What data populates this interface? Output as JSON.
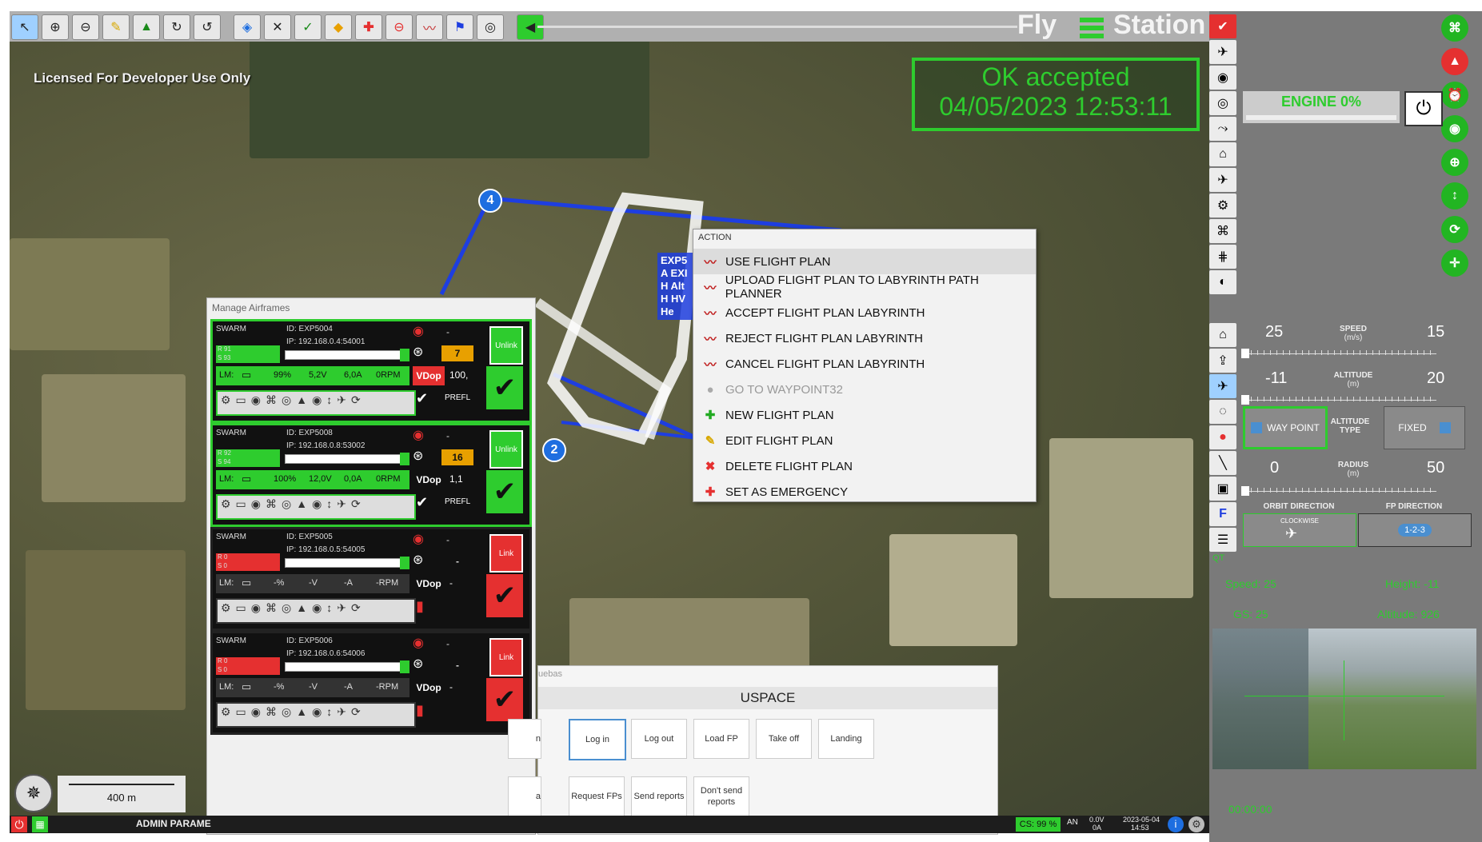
{
  "app": {
    "title_left": "Fly",
    "title_right": "Station",
    "license": "Licensed For Developer Use Only"
  },
  "status_box": {
    "line1": "OK accepted",
    "line2": "04/05/2023 12:53:11"
  },
  "engine": {
    "label": "ENGINE 0%"
  },
  "waypoints": {
    "w4": "4",
    "w2": "2"
  },
  "drone_label": {
    "id": "EXP5",
    "a": "A EXI",
    "h": "H Alt",
    "h2": "H HV",
    "he": "He"
  },
  "action_menu": {
    "header": "ACTION",
    "items": [
      {
        "label": "USE FLIGHT PLAN",
        "icon": "flight-plan-icon",
        "state": "active"
      },
      {
        "label": "UPLOAD FLIGHT PLAN TO LABYRINTH PATH PLANNER",
        "icon": "flight-plan-icon",
        "state": "normal"
      },
      {
        "label": "ACCEPT FLIGHT PLAN LABYRINTH",
        "icon": "flight-plan-icon",
        "state": "normal"
      },
      {
        "label": "REJECT FLIGHT PLAN LABYRINTH",
        "icon": "flight-plan-icon",
        "state": "normal"
      },
      {
        "label": "CANCEL FLIGHT PLAN LABYRINTH",
        "icon": "flight-plan-icon",
        "state": "normal"
      },
      {
        "label": "GO TO WAYPOINT32",
        "icon": "circle-icon",
        "state": "disabled"
      },
      {
        "label": "NEW FLIGHT PLAN",
        "icon": "plus-icon",
        "state": "normal"
      },
      {
        "label": "EDIT FLIGHT PLAN",
        "icon": "pencil-icon",
        "state": "normal"
      },
      {
        "label": "DELETE FLIGHT PLAN",
        "icon": "delete-icon",
        "state": "normal"
      },
      {
        "label": "SET AS EMERGENCY",
        "icon": "emergency-icon",
        "state": "normal"
      }
    ]
  },
  "manage_airframes": {
    "title": "Manage Airframes",
    "cards": [
      {
        "swarm": "SWARM",
        "id": "ID: EXP5004",
        "ip": "IP: 192.168.0.4:54001",
        "r": "R 91",
        "s": "S 93",
        "lm": "LM:",
        "batt": "99%",
        "volt": "5,2V",
        "amp": "6,0A",
        "rpm": "0RPM",
        "vdop": "VDop",
        "sats": "7",
        "vdop_val": "100,",
        "prefl": "PREFL",
        "dash": "-",
        "link": "Unlink",
        "linked": true,
        "color": "#2ecc2e"
      },
      {
        "swarm": "SWARM",
        "id": "ID: EXP5008",
        "ip": "IP: 192.168.0.8:53002",
        "r": "R 92",
        "s": "S 94",
        "lm": "LM:",
        "batt": "100%",
        "volt": "12,0V",
        "amp": "0,0A",
        "rpm": "0RPM",
        "vdop": "VDop",
        "sats": "16",
        "vdop_val": "1,1",
        "prefl": "PREFL",
        "dash": "-",
        "link": "Unlink",
        "linked": true,
        "color": "#2ecc2e"
      },
      {
        "swarm": "SWARM",
        "id": "ID: EXP5005",
        "ip": "IP: 192.168.0.5:54005",
        "r": "R 0",
        "s": "S 0",
        "lm": "LM:",
        "batt": "-%",
        "volt": "-V",
        "amp": "-A",
        "rpm": "-RPM",
        "vdop": "VDop",
        "sats": "-",
        "vdop_val": "-",
        "prefl": "",
        "dash": "-",
        "link": "Link",
        "linked": false,
        "color": "#e53030"
      },
      {
        "swarm": "SWARM",
        "id": "ID: EXP5006",
        "ip": "IP: 192.168.0.6:54006",
        "r": "R 0",
        "s": "S 0",
        "lm": "LM:",
        "batt": "-%",
        "volt": "-V",
        "amp": "-A",
        "rpm": "-RPM",
        "vdop": "VDop",
        "sats": "-",
        "vdop_val": "-",
        "prefl": "",
        "dash": "-",
        "link": "Link",
        "linked": false,
        "color": "#e53030"
      }
    ]
  },
  "uspace": {
    "tab": "uebas",
    "title": "USPACE",
    "row1": [
      "n",
      "Log in",
      "Log out",
      "Load FP",
      "Take off",
      "Landing"
    ],
    "row2": [
      "a",
      "Request FPs",
      "Send reports",
      "Don't send reports"
    ]
  },
  "scale": {
    "label": "400 m"
  },
  "status_bar": {
    "admin": "ADMIN PARAME",
    "cs": "CS: 99 %",
    "an": "AN",
    "volt": "0.0V",
    "amp": "0A",
    "date": "2023-05-04",
    "time": "14:53"
  },
  "controls": {
    "speed": {
      "label": "SPEED",
      "unit": "(m/s)",
      "min": "25",
      "max": "15"
    },
    "altitude": {
      "label": "ALTITUDE",
      "unit": "(m)",
      "min": "-11",
      "max": "20"
    },
    "altitude_type": {
      "label": "ALTITUDE TYPE",
      "waypoint": "WAY POINT",
      "fixed": "FIXED"
    },
    "radius": {
      "label": "RADIUS",
      "unit": "(m)",
      "min": "0",
      "max": "50"
    },
    "orbit_direction": {
      "label": "ORBIT DIRECTION",
      "value": "CLOCKWISE"
    },
    "fp_direction": {
      "label": "FP DIRECTION",
      "value": "1-2-3"
    },
    "qt": "QT",
    "readouts": {
      "speed": "Speed: 25",
      "height": "Height: -11",
      "gs": "GS: 25",
      "altitude": "Altitude: 926"
    },
    "timer": "00:00:00"
  },
  "colors": {
    "accent": "#2ecc2e",
    "danger": "#e53030",
    "route": "#1e3ee0"
  }
}
